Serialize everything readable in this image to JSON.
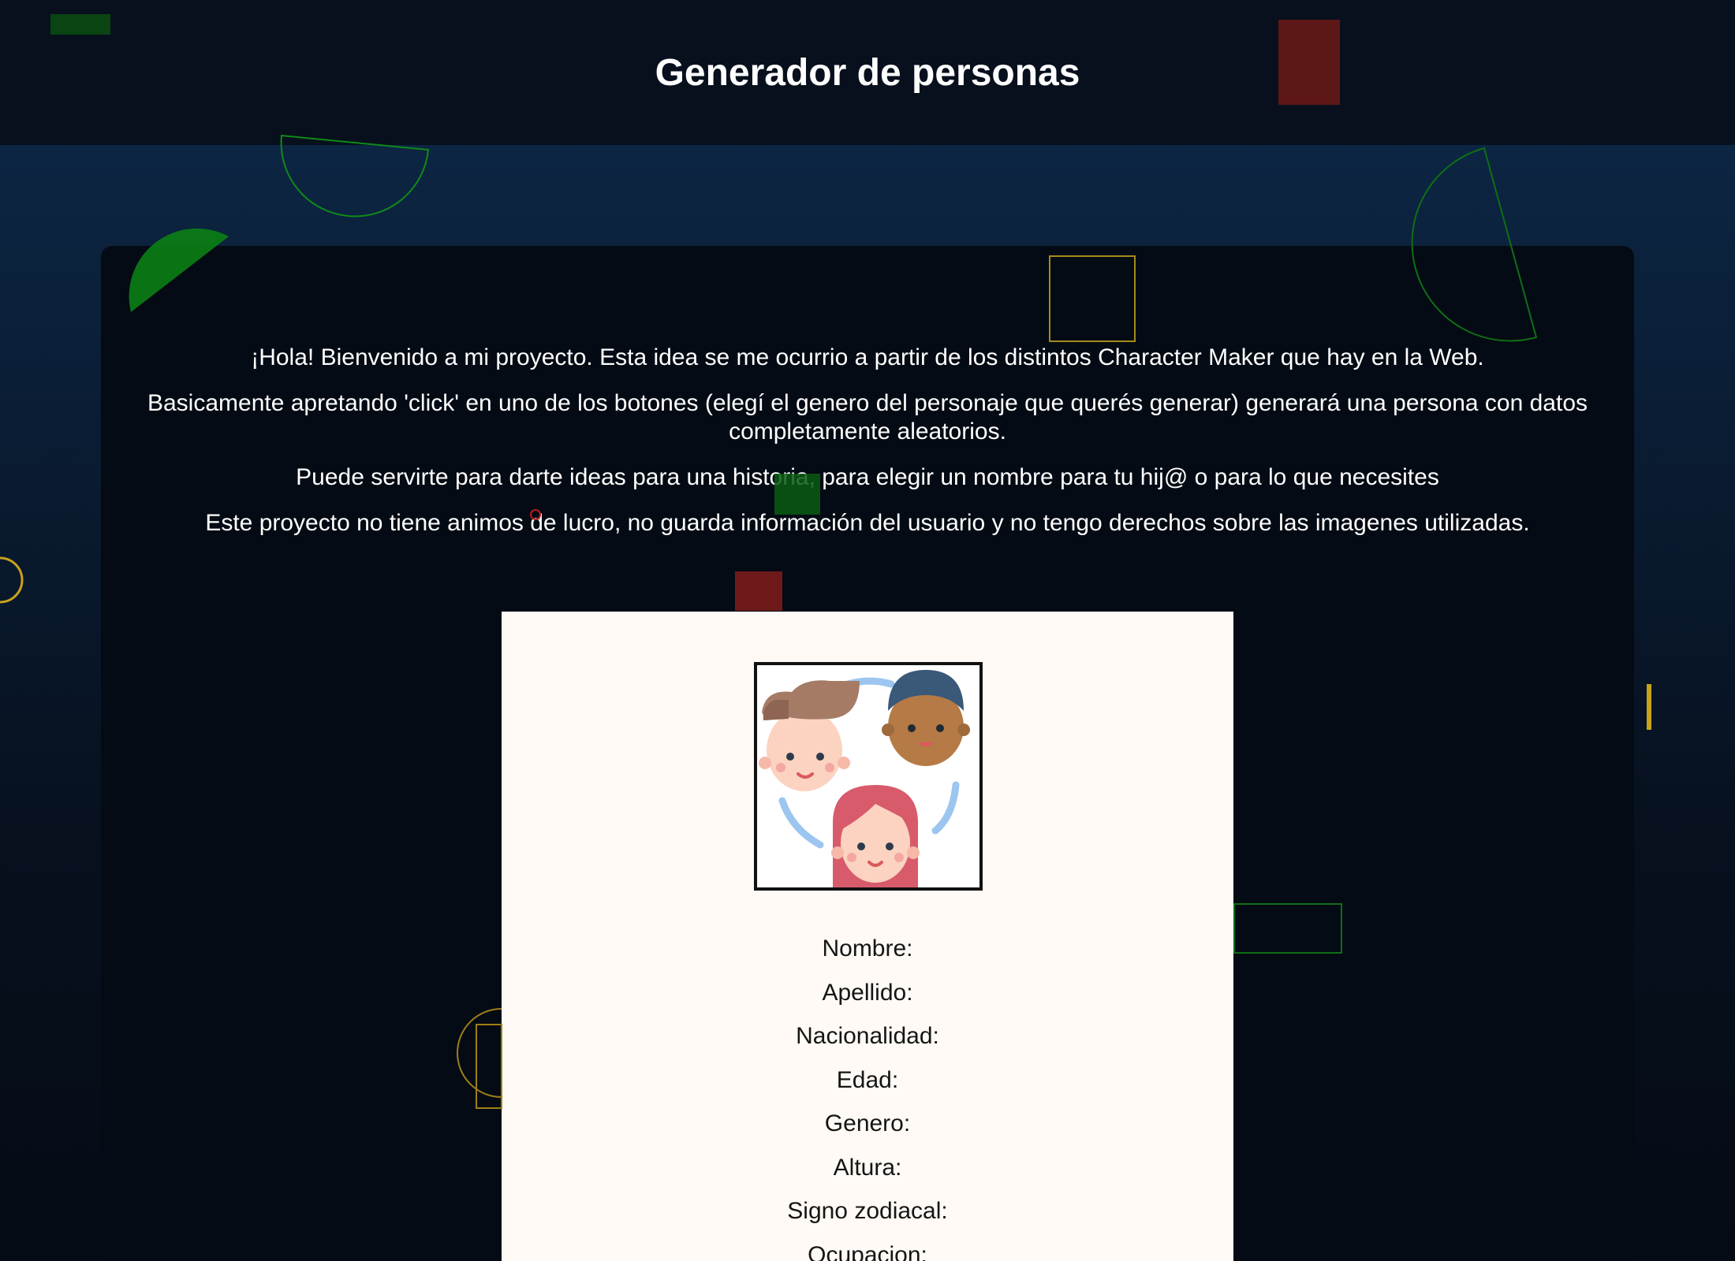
{
  "header": {
    "title": "Generador de personas"
  },
  "intro": {
    "paragraphs": [
      "¡Hola! Bienvenido a mi proyecto. Esta idea se me ocurrio a partir de los distintos Character Maker que hay en la Web.",
      "Basicamente apretando 'click' en uno de los botones (elegí el genero del personaje que querés generar) generará una persona con datos completamente aleatorios.",
      "Puede servirte para darte ideas para una historia, para elegir un nombre para tu hij@ o para lo que necesites",
      "Este proyecto no tiene animos de lucro, no guarda información del usuario y no tengo derechos sobre las imagenes utilizadas."
    ]
  },
  "card": {
    "avatar_icon": "three-people-faces-icon",
    "fields": [
      "Nombre:",
      "Apellido:",
      "Nacionalidad:",
      "Edad:",
      "Genero:",
      "Altura:",
      "Signo zodiacal:",
      "Ocupacion:"
    ]
  },
  "colors": {
    "header_bg": "#07101c",
    "panel_bg": "#050b14",
    "card_bg": "#fffaf5",
    "deco_green": "#0a8a12",
    "deco_red": "#6b1616",
    "deco_yellow": "#c9a21b"
  }
}
